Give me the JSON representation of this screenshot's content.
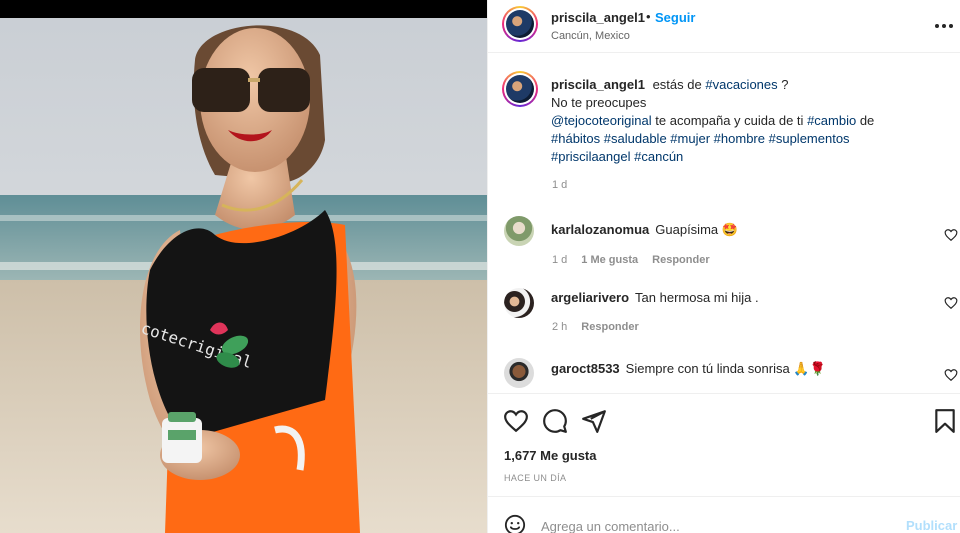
{
  "post": {
    "username": "priscila_angel1",
    "follow_label": "Seguir",
    "separator": "•",
    "location": "Cancún, Mexico",
    "more_icon": "more-horizontal-icon",
    "photo_shirt_text": "cotecriginal"
  },
  "caption": {
    "username": "priscila_angel1",
    "t1": "estás de",
    "h1": "#vacaciones",
    "t2": "?",
    "line2": "No te preocupes",
    "mention": "@tejocoteoriginal",
    "t3": "te acompaña y cuida de ti",
    "h2": "#cambio",
    "t4": "de",
    "h3": "#hábitos",
    "h4": "#saludable",
    "h5": "#mujer",
    "h6": "#hombre",
    "h7": "#suplementos",
    "h8": "#priscilaangel",
    "h9": "#cancún",
    "time": "1 d"
  },
  "comments": [
    {
      "username": "karlalozanomua",
      "text": "Guapísima 🤩",
      "time": "1 d",
      "likes": "1 Me gusta",
      "reply": "Responder"
    },
    {
      "username": "argeliarivero",
      "text": "Tan hermosa mi hija .",
      "time": "2 h",
      "reply": "Responder"
    },
    {
      "username": "garoct8533",
      "text": "Siempre con tú linda sonrisa 🙏🌹"
    }
  ],
  "actions": {
    "icons": [
      "heart-icon",
      "comment-icon",
      "share-icon",
      "bookmark-icon"
    ],
    "likes": "1,677 Me gusta",
    "posted": "HACE UN DÍA"
  },
  "add_comment": {
    "placeholder": "Agrega un comentario...",
    "publish": "Publicar"
  },
  "colors": {
    "link": "#0095f6",
    "hashtag": "#00376b",
    "muted": "#8e8e8e",
    "publish_disabled": "#b2dffc"
  }
}
